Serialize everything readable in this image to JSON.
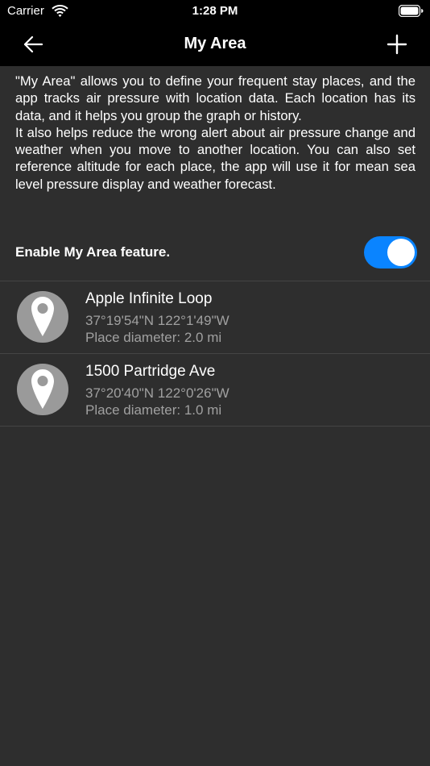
{
  "status_bar": {
    "carrier": "Carrier",
    "time": "1:28 PM"
  },
  "nav": {
    "title": "My Area",
    "back_icon": "arrow-left-icon",
    "add_icon": "plus-icon"
  },
  "description": {
    "paragraph1": "\"My Area\" allows you to define your frequent stay places, and the app tracks air pressure with location data. Each location has its data, and it helps you group the graph or history.",
    "paragraph2": "It also helps reduce the wrong alert about air pressure change and weather when you move to another location. You can also set reference altitude for each place, the app will use it for mean sea level pressure display and weather forecast."
  },
  "toggle": {
    "label": "Enable My Area feature.",
    "enabled": true,
    "color": "#0a84ff"
  },
  "places": [
    {
      "name": "Apple Infinite Loop",
      "coords": "37°19'54\"N 122°1'49\"W",
      "diameter": "Place diameter: 2.0 mi",
      "icon": "map-pin-icon"
    },
    {
      "name": "1500 Partridge Ave",
      "coords": "37°20'40\"N 122°0'26\"W",
      "diameter": "Place diameter: 1.0 mi",
      "icon": "map-pin-icon"
    }
  ]
}
